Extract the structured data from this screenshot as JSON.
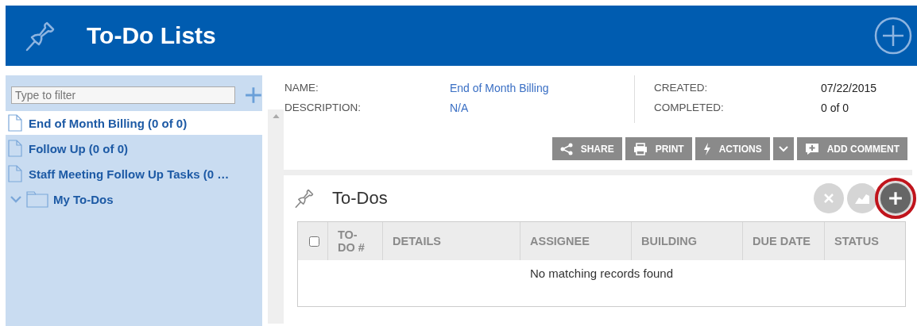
{
  "header": {
    "title": "To-Do Lists"
  },
  "sidebar": {
    "filter": {
      "placeholder": "Type to filter"
    },
    "items": [
      {
        "label": "End of Month Billing (0 of 0)",
        "kind": "file",
        "selected": true
      },
      {
        "label": "Follow Up (0 of 0)",
        "kind": "file",
        "selected": false
      },
      {
        "label": "Staff Meeting Follow Up Tasks (0 …",
        "kind": "file",
        "selected": false
      },
      {
        "label": "My To-Dos",
        "kind": "folder",
        "selected": false,
        "expanded": true
      }
    ]
  },
  "details": {
    "left": [
      {
        "label": "NAME:",
        "value": "End of Month Billing"
      },
      {
        "label": "DESCRIPTION:",
        "value": "N/A"
      }
    ],
    "right": [
      {
        "label": "CREATED:",
        "value": "07/22/2015"
      },
      {
        "label": "COMPLETED:",
        "value": "0 of 0"
      }
    ]
  },
  "toolbar": [
    {
      "kind": "share",
      "label": "SHARE"
    },
    {
      "kind": "print",
      "label": "PRINT"
    },
    {
      "kind": "actions",
      "label": "ACTIONS"
    },
    {
      "kind": "caret"
    },
    {
      "kind": "comment",
      "label": "ADD COMMENT"
    }
  ],
  "todos": {
    "title": "To-Dos",
    "buttons": [
      {
        "kind": "delete",
        "disabled": true,
        "highlighted": false
      },
      {
        "kind": "chart",
        "disabled": true,
        "highlighted": false
      },
      {
        "kind": "add",
        "disabled": false,
        "highlighted": true
      }
    ],
    "select_all": {
      "checked": false
    },
    "columns": [
      "TO-\nDO #",
      "DETAILS",
      "ASSIGNEE",
      "BUILDING",
      "DUE DATE",
      "STATUS"
    ],
    "empty_message": "No matching records found"
  }
}
